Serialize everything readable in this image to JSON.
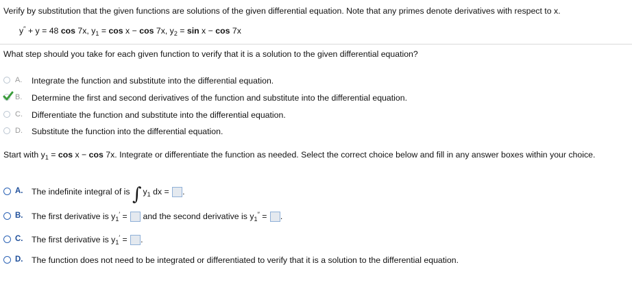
{
  "header": {
    "instruction": "Verify by substitution that the given functions are solutions of the given differential equation. Note that any primes denote derivatives with respect to x."
  },
  "equation": {
    "lhs_y": "y",
    "lhs_primes": "′′",
    "lhs_rest": " + y = 48 ",
    "cos1": "cos",
    "arg1": " 7x, y",
    "sub1": "1",
    "eq1": " = ",
    "cos2": "cos",
    "x_minus": " x − ",
    "cos3": "cos",
    "arg3": " 7x, y",
    "sub2": "2",
    "eq2": " = ",
    "sin": "sin",
    "x_minus2": " x − ",
    "cos4": "cos",
    "arg4": " 7x"
  },
  "question1": {
    "prompt": "What step should you take for each given function to verify that it is a solution to the given differential equation?",
    "options": [
      {
        "letter": "A.",
        "text": "Integrate the function and substitute into the differential equation."
      },
      {
        "letter": "B.",
        "text": "Determine the first and second derivatives of the function and substitute into the differential equation."
      },
      {
        "letter": "C.",
        "text": "Differentiate the function and substitute into the differential equation."
      },
      {
        "letter": "D.",
        "text": "Substitute the function into the differential equation."
      }
    ],
    "selected": "B.",
    "check_color": "#3a9c3a"
  },
  "question2": {
    "start_a": "Start with y",
    "start_sub": "1",
    "start_b": " = ",
    "start_cos": "cos",
    "start_c": " x − ",
    "start_cos2": "cos",
    "start_d": " 7x. Integrate or differentiate the function as needed. Select the correct choice below and fill in any answer boxes within your choice.",
    "options": {
      "a": {
        "letter": "A.",
        "text": "The indefinite integral of is",
        "integral": "∫",
        "y": "y",
        "sub": "1",
        "dx": " dx ="
      },
      "b": {
        "letter": "B.",
        "text1": "The first derivative is y",
        "sub1": "1",
        "prime1": "′",
        "eq1": " =",
        "text2": "and the second derivative is y",
        "sub2": "1",
        "prime2": "′′",
        "eq2": " ="
      },
      "c": {
        "letter": "C.",
        "text": "The first derivative is y",
        "sub": "1",
        "prime": "′",
        "eq": " ="
      },
      "d": {
        "letter": "D.",
        "text": "The function does not need to be integrated or differentiated to verify that it is a solution to the differential equation."
      }
    },
    "period": "."
  },
  "colors": {
    "radio_blue": "#2b62b5",
    "answer_box_border": "#8fb0d8",
    "answer_box_fill": "#e4e9ef"
  }
}
